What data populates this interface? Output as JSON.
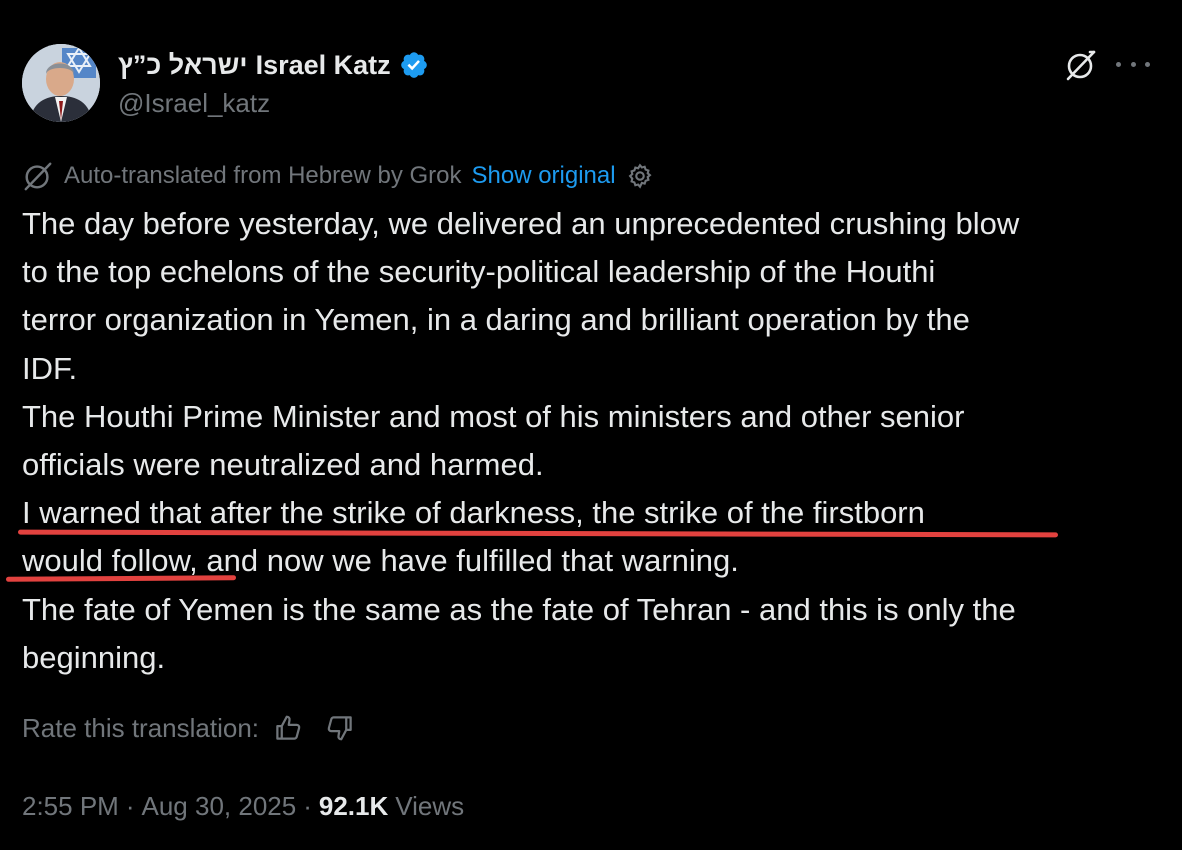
{
  "author": {
    "display_name_hebrew": "ישראל כ”ץ",
    "display_name_english": "Israel Katz",
    "handle": "@Israel_katz",
    "verified": true
  },
  "translation": {
    "notice": "Auto-translated from Hebrew by Grok",
    "show_original_label": "Show original"
  },
  "tweet": {
    "lines": [
      "The day before yesterday, we delivered an unprecedented crushing blow",
      "to the top echelons of the security-political leadership of the Houthi",
      "terror organization in Yemen, in a daring and brilliant operation by the",
      "IDF.",
      "The Houthi Prime Minister and most of his ministers and other senior",
      "officials were neutralized and harmed.",
      "I warned that after the strike of darkness, the strike of the firstborn",
      "would follow, and now we have fulfilled that warning.",
      "The fate of Yemen is the same as the fate of Tehran - and this is only the",
      "beginning."
    ]
  },
  "rating": {
    "label": "Rate this translation:"
  },
  "meta": {
    "time": "2:55 PM",
    "date": "Aug 30, 2025",
    "separator": "·",
    "views_count": "92.1K",
    "views_label": "Views"
  },
  "colors": {
    "background": "#000000",
    "text_primary": "#e7e9ea",
    "text_secondary": "#71767b",
    "link": "#1d9bf0",
    "verified": "#1d9bf0",
    "annotation_underline": "#e2423f"
  },
  "icons": {
    "verified": "verified-badge-icon",
    "grok": "grok-icon",
    "more": "more-options-icon",
    "settings": "gear-icon",
    "thumbs_up": "thumbs-up-icon",
    "thumbs_down": "thumbs-down-icon"
  }
}
